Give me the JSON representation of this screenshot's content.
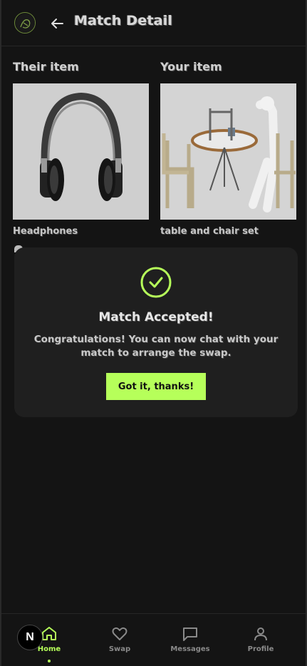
{
  "header": {
    "title": "Match Detail"
  },
  "their_item": {
    "heading": "Their item",
    "name": "Headphones"
  },
  "your_item": {
    "heading": "Your item",
    "name": "table and chair set"
  },
  "modal": {
    "title": "Match Accepted!",
    "message": "Congratulations! You can now chat with your match to arrange the swap.",
    "button_label": "Got it, thanks!"
  },
  "nav": {
    "home": "Home",
    "swap": "Swap",
    "messages": "Messages",
    "profile": "Profile"
  },
  "badge": "N",
  "colors": {
    "accent": "#b6ff5a",
    "background": "#141414",
    "modal": "#1f1f1f"
  }
}
